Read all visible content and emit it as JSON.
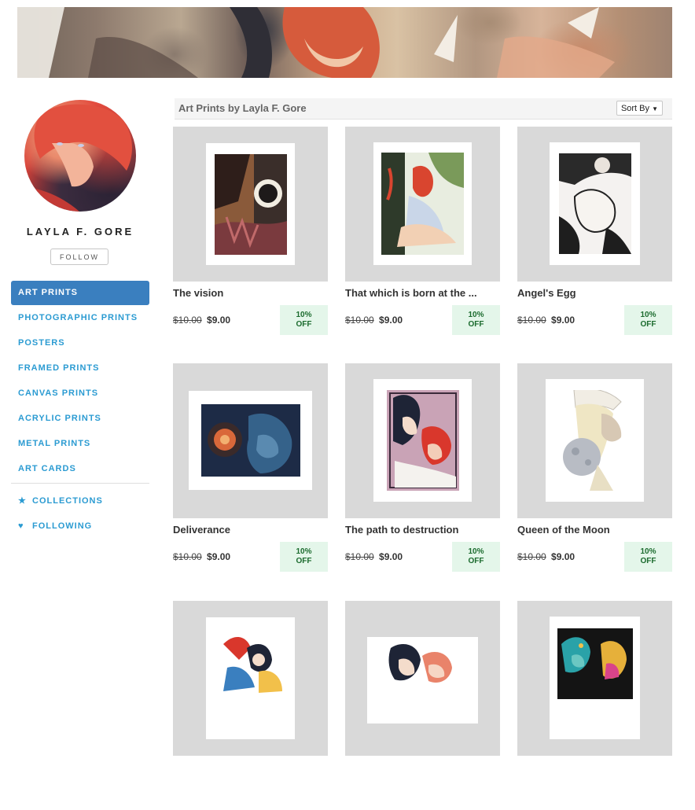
{
  "artist": {
    "name": "LAYLA F. GORE",
    "follow_label": "FOLLOW"
  },
  "nav": {
    "items": [
      {
        "label": "ART PRINTS",
        "active": true
      },
      {
        "label": "PHOTOGRAPHIC PRINTS"
      },
      {
        "label": "POSTERS"
      },
      {
        "label": "FRAMED PRINTS"
      },
      {
        "label": "CANVAS PRINTS"
      },
      {
        "label": "ACRYLIC PRINTS"
      },
      {
        "label": "METAL PRINTS"
      },
      {
        "label": "ART CARDS"
      }
    ],
    "collections_label": "COLLECTIONS",
    "following_label": "FOLLOWING"
  },
  "listing": {
    "title": "Art Prints by Layla F. Gore",
    "sort_label": "Sort By"
  },
  "products": [
    {
      "title": "The vision",
      "old_price": "$10.00",
      "price": "$9.00",
      "badge_line1": "10%",
      "badge_line2": "OFF"
    },
    {
      "title": "That which is born at the ...",
      "old_price": "$10.00",
      "price": "$9.00",
      "badge_line1": "10%",
      "badge_line2": "OFF"
    },
    {
      "title": "Angel's Egg",
      "old_price": "$10.00",
      "price": "$9.00",
      "badge_line1": "10%",
      "badge_line2": "OFF"
    },
    {
      "title": "Deliverance",
      "old_price": "$10.00",
      "price": "$9.00",
      "badge_line1": "10%",
      "badge_line2": "OFF"
    },
    {
      "title": "The path to destruction",
      "old_price": "$10.00",
      "price": "$9.00",
      "badge_line1": "10%",
      "badge_line2": "OFF"
    },
    {
      "title": "Queen of the Moon",
      "old_price": "$10.00",
      "price": "$9.00",
      "badge_line1": "10%",
      "badge_line2": "OFF"
    },
    {
      "title": "",
      "old_price": "",
      "price": "",
      "badge_line1": "",
      "badge_line2": ""
    },
    {
      "title": "",
      "old_price": "",
      "price": "",
      "badge_line1": "",
      "badge_line2": ""
    },
    {
      "title": "",
      "old_price": "",
      "price": "",
      "badge_line1": "",
      "badge_line2": ""
    }
  ],
  "colors": {
    "accent": "#2b9bd2",
    "active_nav": "#3a7fbf",
    "badge_bg": "#e4f6ea",
    "badge_text": "#1b6b2e"
  }
}
